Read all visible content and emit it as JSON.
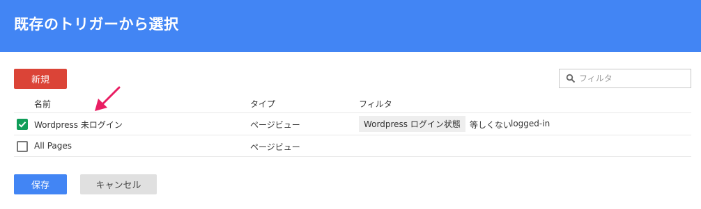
{
  "header": {
    "title": "既存のトリガーから選択"
  },
  "toolbar": {
    "new_label": "新規"
  },
  "search": {
    "placeholder": "フィルタ",
    "value": ""
  },
  "table": {
    "columns": [
      "名前",
      "タイプ",
      "フィルタ"
    ],
    "rows": [
      {
        "checked": true,
        "name": "Wordpress 未ログイン",
        "type": "ページビュー",
        "filter": {
          "variable": "Wordpress ログイン状態",
          "operator": "等しくない",
          "value": "logged-in"
        }
      },
      {
        "checked": false,
        "name": "All Pages",
        "type": "ページビュー",
        "filter": {
          "variable": "",
          "operator": "",
          "value": ""
        }
      }
    ]
  },
  "footer": {
    "save_label": "保存",
    "cancel_label": "キャンセル"
  },
  "colors": {
    "header": "#4285f4",
    "new_button": "#db4437",
    "save_button": "#4285f4",
    "cancel_button": "#e0e0e0",
    "checkbox_checked": "#0f9d58",
    "annotation_arrow": "#e91e63"
  },
  "icons": {
    "search": "search-icon",
    "check": "checkmark-icon",
    "annotation": "annotation-arrow-icon"
  }
}
